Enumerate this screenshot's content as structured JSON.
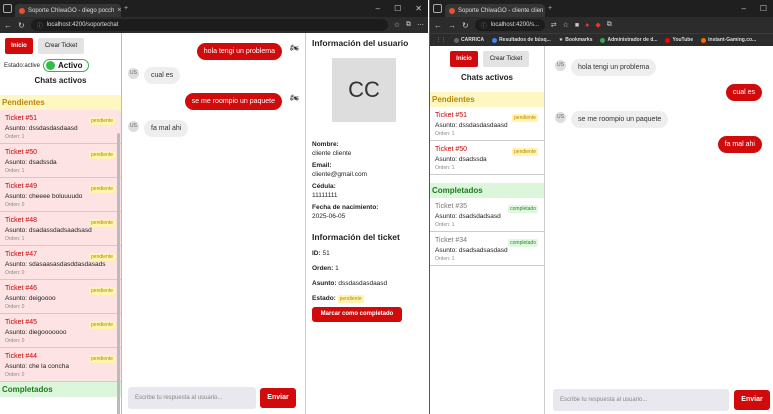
{
  "w1": {
    "tab_title": "Soporte ChiwaGO - diego pocch",
    "url": "localhost:4200/soportechat",
    "sidebar": {
      "inicio": "Inicio",
      "crear": "Crear Ticket",
      "estado_label": "Estado:active",
      "estado_toggle": "Activo",
      "chats_activos": "Chats activos",
      "pendientes": "Pendientes",
      "completados": "Completados",
      "tickets": [
        {
          "num": "Ticket #51",
          "asunto": "Asunto: dssdasdasdaasd",
          "orden": "Orden: 1",
          "estado": "pendiente",
          "count": ""
        },
        {
          "num": "Ticket #50",
          "asunto": "Asunto: dsadssda",
          "orden": "Orden: 1",
          "estado": "pendiente",
          "count": "2"
        },
        {
          "num": "Ticket #49",
          "asunto": "Asunto: cheeee boluuuudo",
          "orden": "Orden: 0",
          "estado": "pendiente",
          "count": ""
        },
        {
          "num": "Ticket #48",
          "asunto": "Asunto: dsadassdadsaadsasd",
          "orden": "Orden: 1",
          "estado": "pendiente",
          "count": ""
        },
        {
          "num": "Ticket #47",
          "asunto": "Asunto: sdasaasasdasddasdasads",
          "orden": "Orden: 0",
          "estado": "pendiente",
          "count": ""
        },
        {
          "num": "Ticket #46",
          "asunto": "Asunto: deigoooo",
          "orden": "Orden: 0",
          "estado": "pendiente",
          "count": ""
        },
        {
          "num": "Ticket #45",
          "asunto": "Asunto: diegooooooo",
          "orden": "Orden: 0",
          "estado": "pendiente",
          "count": ""
        },
        {
          "num": "Ticket #44",
          "asunto": "Asunto: che la concha",
          "orden": "Orden: 0",
          "estado": "pendiente",
          "count": ""
        }
      ]
    },
    "chat": {
      "m1": "hola tengi un problema",
      "m2": "cual es",
      "m3": "se me roompio un paquete",
      "m4": "fa mal ahi",
      "avatar": "US",
      "placeholder": "Escribe tu respuesta al usuario...",
      "send": "Enviar"
    },
    "info": {
      "title": "Información del usuario",
      "avatar": "CC",
      "nombre_l": "Nombre:",
      "nombre": "cliente cliente",
      "email_l": "Email:",
      "email": "cliente@gmail.com",
      "cedula_l": "Cédula:",
      "cedula": "11111111",
      "fecha_l": "Fecha de nacimiento:",
      "fecha": "2025-06-05",
      "ticket_title": "Información del ticket",
      "id_l": "ID:",
      "id": "51",
      "orden_l": "Orden:",
      "orden": "1",
      "asunto_l": "Asunto:",
      "asunto": "dssdasdasdaasd",
      "estado_l": "Estado:",
      "estado": "pendiente",
      "mark": "Marcar como completado"
    }
  },
  "w2": {
    "tab_title": "Soporte ChiwaGO - cliente clien",
    "url": "localhost:4200/s...",
    "bookmarks": [
      "CARRICA",
      "Resultados de búsq...",
      "Bookmarks",
      "Administrador de d...",
      "YouTube",
      "instant-Gaming.co..."
    ],
    "sidebar": {
      "inicio": "Inicio",
      "crear": "Crear Ticket",
      "chats_activos": "Chats activos",
      "pendientes": "Pendientes",
      "completados": "Completados",
      "tickets": [
        {
          "num": "Ticket #51",
          "asunto": "Asunto: dssdasdasdaasd",
          "orden": "Orden: 1",
          "estado": "pendiente"
        },
        {
          "num": "Ticket #50",
          "asunto": "Asunto: dsadssda",
          "orden": "Orden: 1",
          "estado": "pendiente"
        }
      ],
      "completed": [
        {
          "num": "Ticket #35",
          "asunto": "Asunto: dsadsdadsasd",
          "orden": "Orden: 1",
          "estado": "completado"
        },
        {
          "num": "Ticket #34",
          "asunto": "Asunto: dsadsadsasdasd",
          "orden": "Orden: 1",
          "estado": "completado"
        }
      ]
    },
    "chat": {
      "m1": "hola tengi un problema",
      "m2": "cual es",
      "m3": "se me roompio un paquete",
      "m4": "fa mal ahi",
      "avatar": "US",
      "placeholder": "Escribe tu respuesta al usuario...",
      "send": "Enviar"
    }
  }
}
